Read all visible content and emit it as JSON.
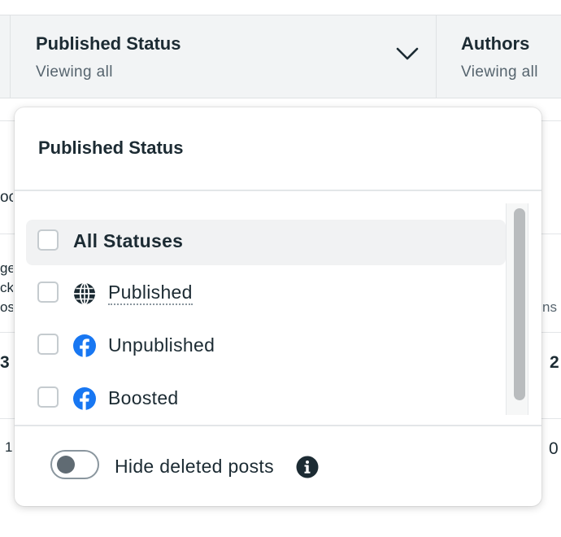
{
  "filters": {
    "published_status": {
      "title": "Published Status",
      "subtitle": "Viewing all"
    },
    "authors": {
      "title": "Authors",
      "subtitle": "Viewing all"
    }
  },
  "background_fragments": [
    "oc",
    "ge",
    "ck",
    "os",
    "ns",
    "3",
    "2",
    "1",
    "0"
  ],
  "dropdown": {
    "title": "Published Status",
    "options": [
      {
        "label": "All Statuses",
        "checked": false,
        "icon": null
      },
      {
        "label": "Published",
        "checked": false,
        "icon": "globe-icon"
      },
      {
        "label": "Unpublished",
        "checked": false,
        "icon": "facebook-icon"
      },
      {
        "label": "Boosted",
        "checked": false,
        "icon": "facebook-icon"
      }
    ],
    "toggle": {
      "label": "Hide deleted posts",
      "on": false
    }
  },
  "colors": {
    "facebook_blue": "#1877f2",
    "text": "#1c2b33",
    "muted": "#56646e",
    "bar_bg": "#f2f4f5"
  }
}
